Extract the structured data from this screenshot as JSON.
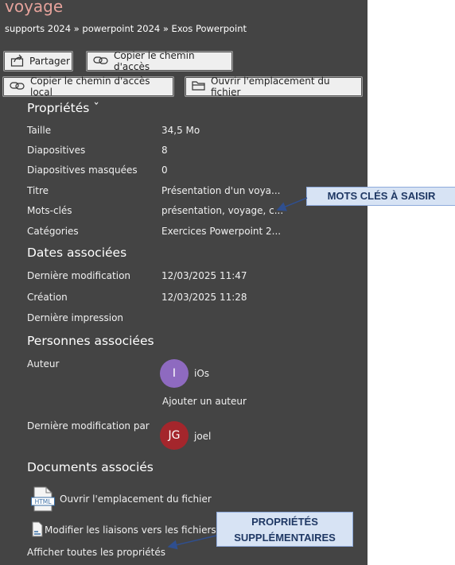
{
  "header": {
    "title": "voyage",
    "breadcrumb": "supports 2024 » powerpoint 2024 » Exos Powerpoint"
  },
  "toolbar": {
    "share_label": "Partager",
    "copy_path_label": "Copier le chemin d'accès",
    "copy_local_path_label": "Copier le chemin d'accès local",
    "open_location_label": "Ouvrir l'emplacement du fichier"
  },
  "properties": {
    "heading": "Propriétés ˇ",
    "rows": [
      {
        "key": "Taille",
        "value": "34,5 Mo"
      },
      {
        "key": "Diapositives",
        "value": "8"
      },
      {
        "key": "Diapositives masquées",
        "value": "0"
      },
      {
        "key": "Titre",
        "value": "Présentation d'un voya..."
      },
      {
        "key": "Mots-clés",
        "value": "présentation, voyage, c..."
      },
      {
        "key": "Catégories",
        "value": "Exercices Powerpoint 2..."
      }
    ]
  },
  "dates": {
    "heading": "Dates associées",
    "rows": [
      {
        "key": "Dernière modification",
        "value": "12/03/2025 11:47"
      },
      {
        "key": "Création",
        "value": "12/03/2025 11:28"
      },
      {
        "key": "Dernière impression",
        "value": ""
      }
    ]
  },
  "people": {
    "heading": "Personnes associées",
    "author_label": "Auteur",
    "author_initial": "I",
    "author_name": "iOs",
    "add_author": "Ajouter un auteur",
    "modified_by_label": "Dernière modification par",
    "modified_by_initials": "JG",
    "modified_by_name": "joel"
  },
  "documents": {
    "heading": "Documents associés",
    "open_location": "Ouvrir l'emplacement du fichier",
    "edit_links": "Modifier les liaisons vers les fichiers",
    "show_all": "Afficher toutes les propriétés"
  },
  "annotations": {
    "keywords": "MOTS CLÉS À SAISIR",
    "extra_line1": "PROPRIÉTÉS",
    "extra_line2": "SUPPLÉMENTAIRES"
  },
  "colors": {
    "panel": "#444444",
    "author_avatar": "#8e6ac0",
    "modifier_avatar": "#a4262c",
    "callout_bg": "#d7e3f4",
    "arrow": "#2f4f8f"
  }
}
